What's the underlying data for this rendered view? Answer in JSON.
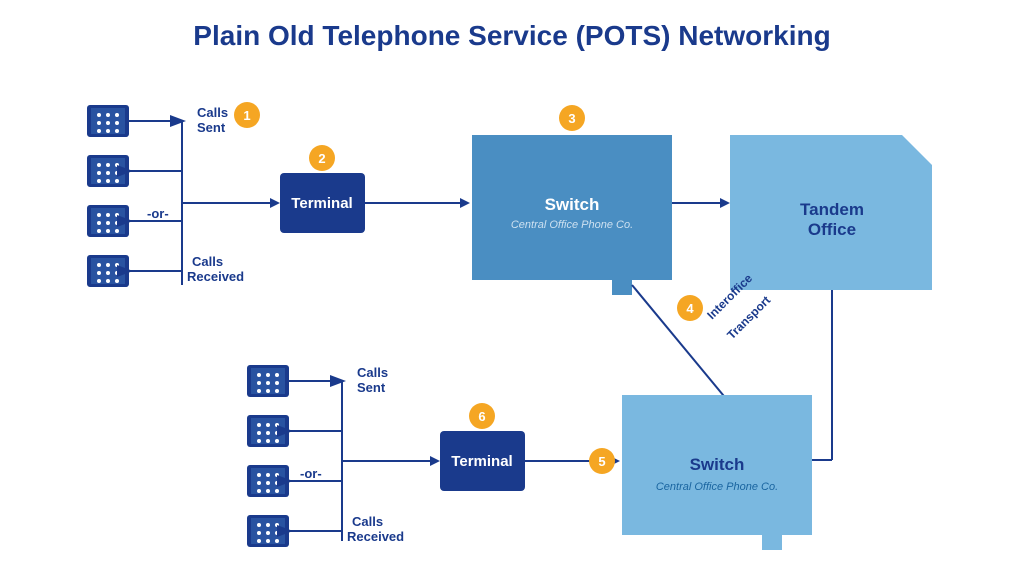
{
  "title": "Plain Old Telephone Service (POTS) Networking",
  "numbers": [
    "1",
    "2",
    "3",
    "4",
    "5",
    "6"
  ],
  "labels": {
    "calls_sent": "Calls\nSent",
    "or": "-or-",
    "calls_received": "Calls\nReceived",
    "terminal": "Terminal",
    "switch_label": "Switch",
    "switch_sublabel": "Central Office Phone Co.",
    "tandem_office": "Tandem\nOffice",
    "interoffice_transport": "Interoffice\nTransport"
  },
  "colors": {
    "dark_blue": "#1a3a8c",
    "mid_blue": "#4d90d4",
    "light_blue": "#7ab8e0",
    "lighter_blue": "#a8cfe8",
    "tandem_blue": "#6aaddd",
    "orange": "#f5a623",
    "white": "#ffffff"
  }
}
